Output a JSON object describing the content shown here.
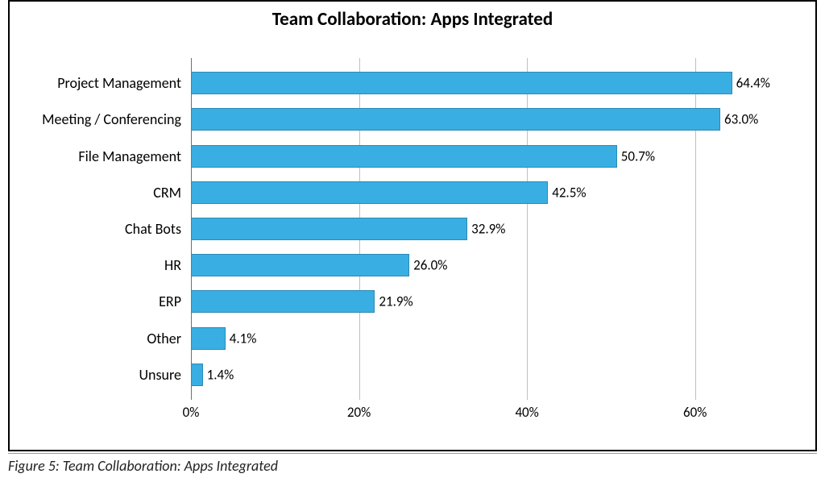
{
  "chart_data": {
    "type": "bar",
    "orientation": "horizontal",
    "title": "Team Collaboration: Apps Integrated",
    "categories": [
      "Project Management",
      "Meeting / Conferencing",
      "File Management",
      "CRM",
      "Chat Bots",
      "HR",
      "ERP",
      "Other",
      "Unsure"
    ],
    "values": [
      64.4,
      63.0,
      50.7,
      42.5,
      32.9,
      26.0,
      21.9,
      4.1,
      1.4
    ],
    "value_labels": [
      "64.4%",
      "63.0%",
      "50.7%",
      "42.5%",
      "32.9%",
      "26.0%",
      "21.9%",
      "4.1%",
      "1.4%"
    ],
    "xlabel": "",
    "ylabel": "",
    "xticks": [
      0,
      20,
      40,
      60
    ],
    "xtick_labels": [
      "0%",
      "20%",
      "40%",
      "60%"
    ],
    "xlim": [
      0,
      70
    ],
    "bar_color": "#39aee2"
  },
  "caption": "Figure 5: Team Collaboration: Apps Integrated"
}
